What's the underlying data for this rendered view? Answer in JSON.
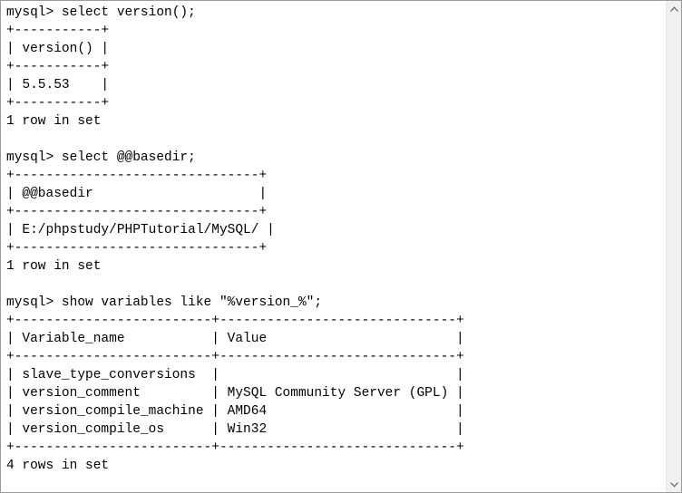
{
  "console": {
    "lines": [
      "mysql> select version();",
      "+-----------+",
      "| version() |",
      "+-----------+",
      "| 5.5.53    |",
      "+-----------+",
      "1 row in set",
      "",
      "mysql> select @@basedir;",
      "+-------------------------------+",
      "| @@basedir                     |",
      "+-------------------------------+",
      "| E:/phpstudy/PHPTutorial/MySQL/ |",
      "+-------------------------------+",
      "1 row in set",
      "",
      "mysql> show variables like \"%version_%\";",
      "+-------------------------+------------------------------+",
      "| Variable_name           | Value                        |",
      "+-------------------------+------------------------------+",
      "| slave_type_conversions  |                              |",
      "| version_comment         | MySQL Community Server (GPL) |",
      "| version_compile_machine | AMD64                        |",
      "| version_compile_os      | Win32                        |",
      "+-------------------------+------------------------------+",
      "4 rows in set"
    ]
  },
  "scrollbar": {
    "up_icon": "chevron-up-icon",
    "down_icon": "chevron-down-icon"
  }
}
